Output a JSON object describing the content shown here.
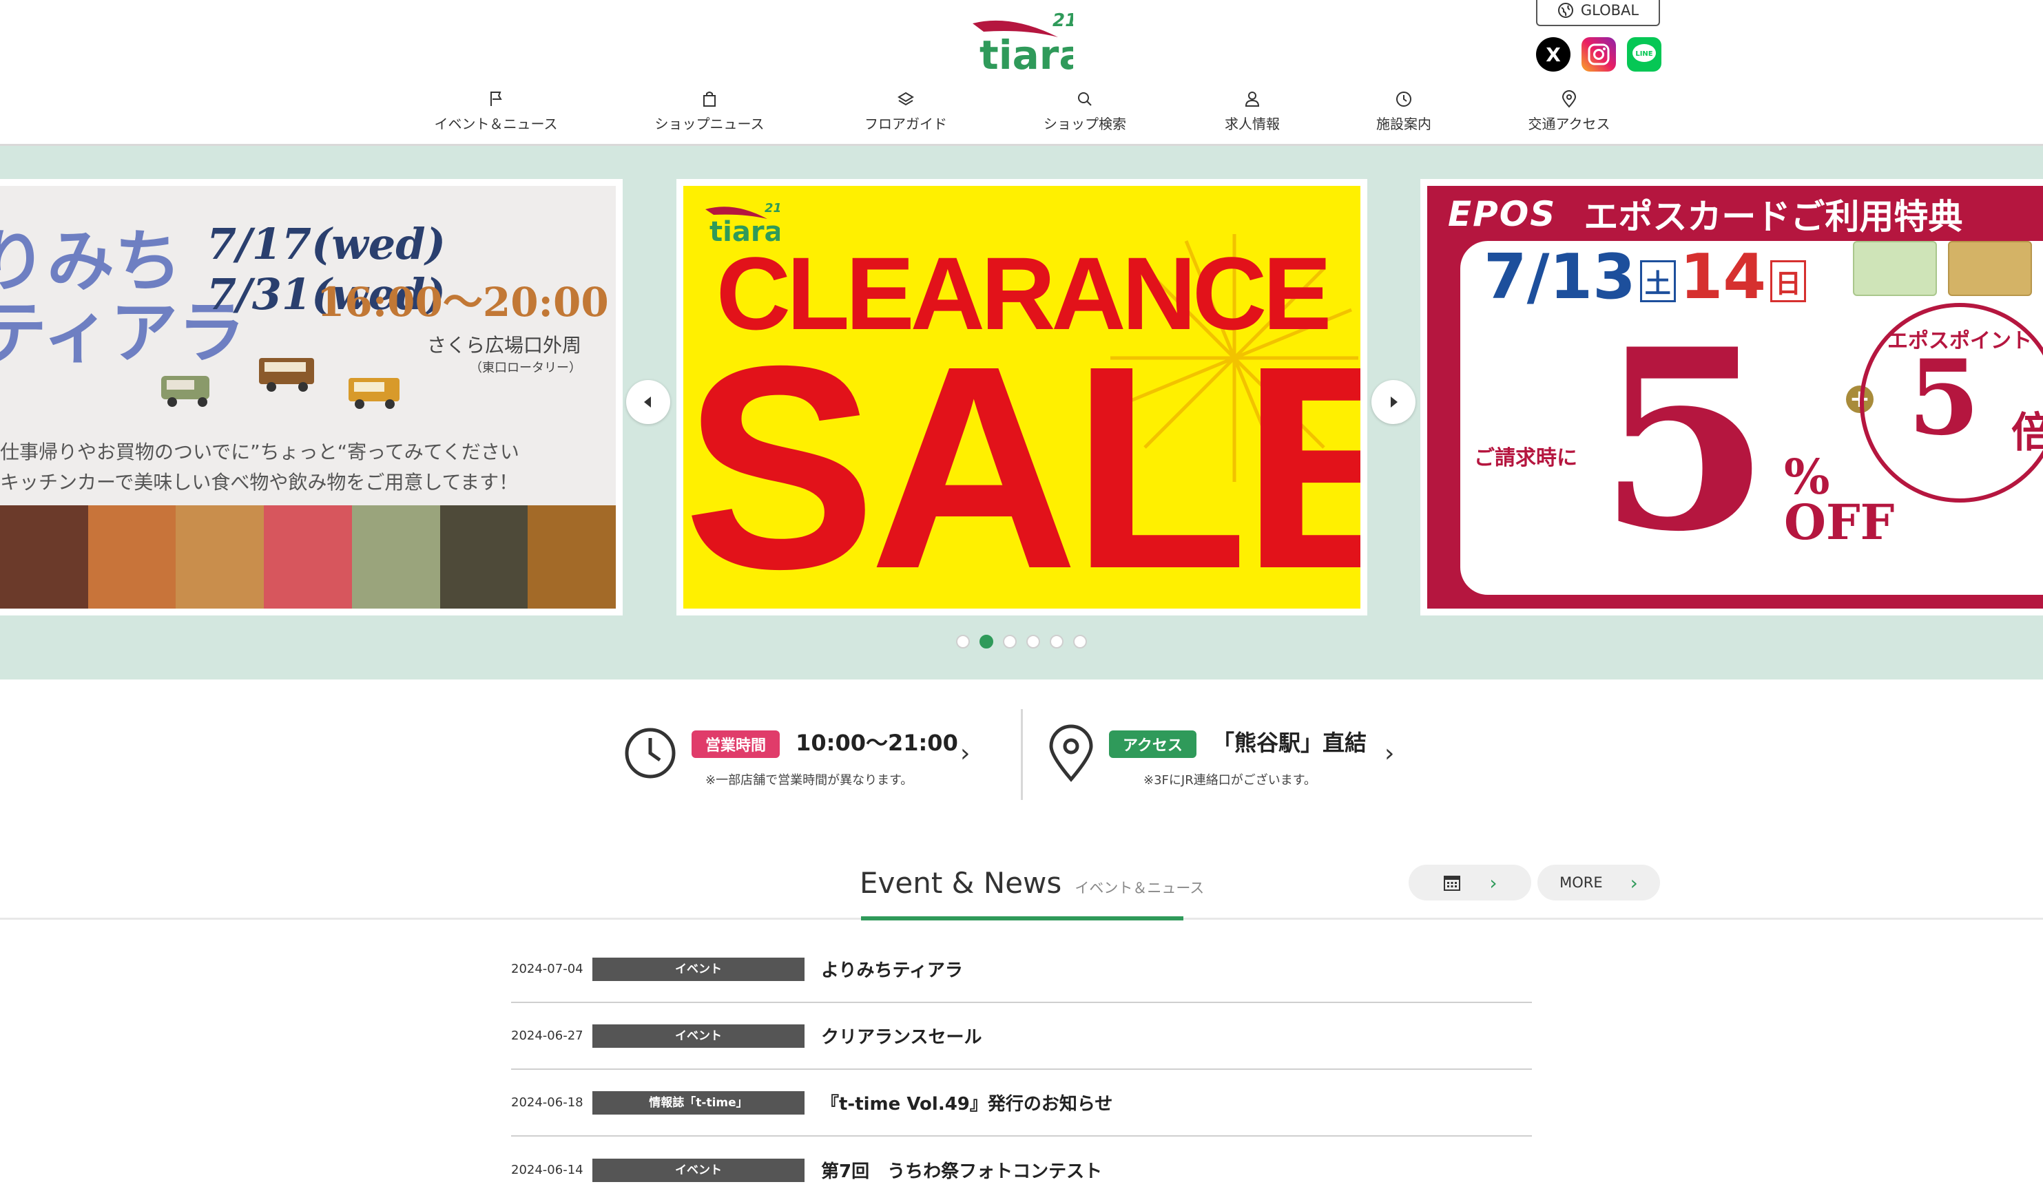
{
  "header": {
    "logo_text": "tiara",
    "logo_superscript": "21",
    "global_label": "GLOBAL",
    "social": {
      "x": "X",
      "instagram": "Instagram",
      "line": "LINE"
    }
  },
  "nav": [
    {
      "label": "イベント＆ニュース",
      "icon": "flag-icon"
    },
    {
      "label": "ショップニュース",
      "icon": "shopping-bag-icon"
    },
    {
      "label": "フロアガイド",
      "icon": "layers-icon"
    },
    {
      "label": "ショップ検索",
      "icon": "search-icon"
    },
    {
      "label": "求人情報",
      "icon": "person-icon"
    },
    {
      "label": "施設案内",
      "icon": "clock-icon"
    },
    {
      "label": "交通アクセス",
      "icon": "map-pin-icon"
    }
  ],
  "hero": {
    "slide_left": {
      "title_line1": "りみち",
      "title_line2": "ティアラ",
      "dates": "7/17(wed)  7/31(wed)",
      "time": "16:00～20:00",
      "place": "さくら広場口外周",
      "place_sub": "（東口ロータリー）",
      "text_line1": "仕事帰りやお買物のついでに”ちょっと“寄ってみてください",
      "text_line2": "キッチンカーで美味しい食べ物や飲み物をご用意してます！"
    },
    "slide_center": {
      "logo_text": "tiara",
      "logo_sup": "21",
      "line1": "CLEARANCE",
      "line2": "SALE"
    },
    "slide_right": {
      "brand": "EPOS",
      "title": "エポスカードご利用特典",
      "dates_a": "7/13",
      "day_a": "土",
      "dates_b": "14",
      "day_b": "日",
      "request_text": "ご請求時に",
      "big_number": "5",
      "pct": "%",
      "off": "OFF",
      "point_label": "エポスポイント",
      "point_number": "5",
      "point_unit": "倍",
      "plus": "+"
    },
    "dots_count": 6,
    "active_dot": 1
  },
  "info": {
    "hours_badge": "営業時間",
    "hours_value": "10:00〜21:00",
    "hours_note": "※一部店舗で営業時間が異なります。",
    "access_badge": "アクセス",
    "access_value": "「熊谷駅」直結",
    "access_note": "※3FにJR連絡口がございます。"
  },
  "news": {
    "title": "Event & News",
    "subtitle": "イベント＆ニュース",
    "more_label": "MORE",
    "items": [
      {
        "date": "2024-07-04",
        "category": "イベント",
        "text": "よりみちティアラ"
      },
      {
        "date": "2024-06-27",
        "category": "イベント",
        "text": "クリアランスセール"
      },
      {
        "date": "2024-06-18",
        "category": "情報誌「t-time」",
        "text": "『t-time Vol.49』発行のお知らせ"
      },
      {
        "date": "2024-06-14",
        "category": "イベント",
        "text": "第7回　うちわ祭フォトコンテスト"
      }
    ]
  },
  "colors": {
    "brand_green": "#2f9a5a",
    "hero_bg": "#d3e7df",
    "sale_yellow": "#fff000",
    "sale_red": "#e2121a",
    "epos_red": "#b5163f",
    "hours_pink": "#e03c6a"
  }
}
